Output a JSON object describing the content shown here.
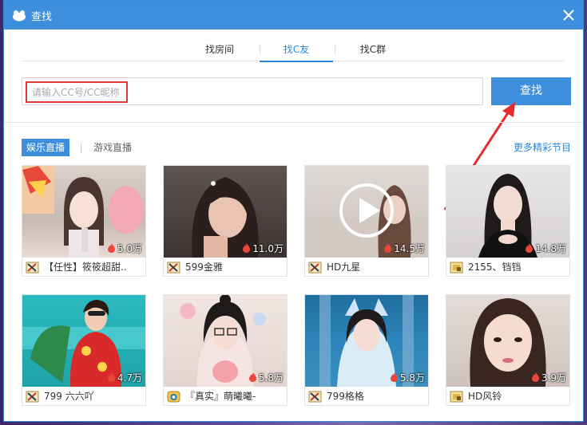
{
  "window": {
    "title": "查找"
  },
  "tabs": [
    {
      "label": "找房间",
      "active": false
    },
    {
      "label": "找C友",
      "active": true
    },
    {
      "label": "找C群",
      "active": false
    }
  ],
  "search": {
    "placeholder": "请输入CC号/CC昵称",
    "button_label": "查找"
  },
  "categories": {
    "active": "娱乐直播",
    "inactive": "游戏直播",
    "more_link": "更多精彩节目"
  },
  "colors": {
    "accent": "#3d8fdc",
    "highlight_border": "#e03b3b",
    "flame": "#e8473a"
  },
  "streams": [
    {
      "name": "【任性】筱筱超甜..",
      "viewers": "5.0万",
      "badge": "sword-badge-icon"
    },
    {
      "name": "599金雅",
      "viewers": "11.0万",
      "badge": "sword-badge-icon"
    },
    {
      "name": "HD九星",
      "viewers": "14.5万",
      "badge": "sword-badge-icon"
    },
    {
      "name": "2155、铛铛",
      "viewers": "14.8万",
      "badge": "shield-badge-icon"
    },
    {
      "name": "799 六六吖",
      "viewers": "4.7万",
      "badge": "sword-badge-icon"
    },
    {
      "name": "『真实』萌曦曦-",
      "viewers": "5.8万",
      "badge": "crown-badge-icon"
    },
    {
      "name": "799格格",
      "viewers": "5.8万",
      "badge": "sword-badge-icon"
    },
    {
      "name": "HD风铃",
      "viewers": "3.9万",
      "badge": "shield-badge-icon"
    }
  ]
}
